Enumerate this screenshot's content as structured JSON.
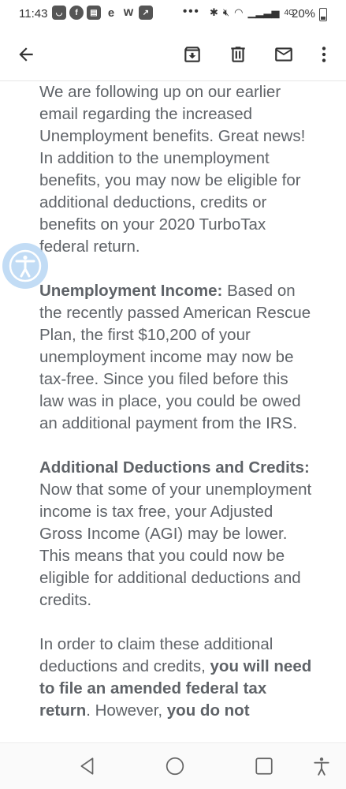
{
  "status_bar": {
    "time": "11:43",
    "dots": "•••",
    "network": "4G",
    "battery": "20%"
  },
  "email": {
    "paragraph1": "We are following up on our earlier email regarding the increased Unemployment benefits. Great news! In addition to the unemployment benefits, you may now be eligible for additional deductions, credits or benefits on your 2020 TurboTax federal return.",
    "p2_bold": "Unemployment Income:",
    "p2_text": " Based on the recently passed American Rescue Plan, the first $10,200 of your unemployment income may now be tax-free. Since you filed before this law was in place, you could be owed an additional payment from the IRS.",
    "p3_bold": "Additional Deductions and Credits:",
    "p3_text": " Now that some of your unemployment income is tax free, your Adjusted Gross Income (AGI) may be lower. This means that you could now be eligible for additional deductions and credits.",
    "p4_a": "In order to claim these additional deductions and credits, ",
    "p4_bold1": "you will need to file an amended federal tax return",
    "p4_b": ". However, ",
    "p4_bold2": "you do not"
  },
  "icons": {
    "back": "arrow-back-icon",
    "archive": "archive-icon",
    "delete": "trash-icon",
    "mark_unread": "mail-icon",
    "more": "more-vert-icon",
    "accessibility": "accessibility-icon"
  }
}
